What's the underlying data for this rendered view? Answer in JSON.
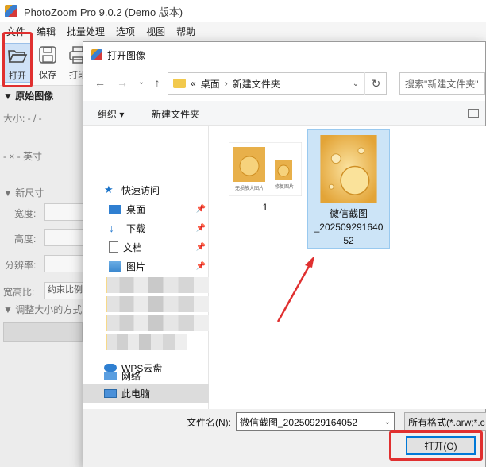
{
  "app": {
    "title": "PhotoZoom Pro 9.0.2 (Demo 版本)",
    "menu": [
      "文件",
      "编辑",
      "批量处理",
      "选项",
      "视图",
      "帮助"
    ],
    "toolbar": {
      "open_label": "打开",
      "save_label": "保存",
      "print_label": "打印"
    },
    "panel": {
      "original_header": "▼ 原始图像",
      "size_line": "大小: - / -",
      "unit_line": "- × - 英寸",
      "new_size_header": "▼ 新尺寸",
      "width_label": "宽度:",
      "height_label": "高度:",
      "resolution_label": "分辨率:",
      "aspect_label": "宽高比:",
      "aspect_value": "约束比例",
      "resize_method_header": "▼ 调整大小的方式"
    }
  },
  "dialog": {
    "title": "打开图像",
    "breadcrumb": [
      "«",
      "桌面",
      "新建文件夹"
    ],
    "search_placeholder": "搜索\"新建文件夹\"",
    "commands": {
      "organize": "组织 ▾",
      "new_folder": "新建文件夹"
    },
    "nav": {
      "quick_access": "快速访问",
      "desktop": "桌面",
      "downloads": "下载",
      "documents": "文档",
      "pictures": "图片",
      "wps_cloud": "WPS云盘",
      "this_pc": "此电脑",
      "network": "网络"
    },
    "files": [
      {
        "name": "1",
        "thumb_caption_left": "无损放大图片",
        "thumb_caption_right": "修复图片"
      },
      {
        "name_lines": [
          "微信截图",
          "_202509291640",
          "52"
        ]
      }
    ],
    "filename_label": "文件名(N):",
    "filename_value": "微信截图_20250929164052",
    "filter_value": "所有格式(*.arw;*.c",
    "open_button": "打开(O)"
  },
  "colors": {
    "highlight_red": "#e03030",
    "selection_blue": "#cce4f7",
    "accent": "#0078d7"
  }
}
